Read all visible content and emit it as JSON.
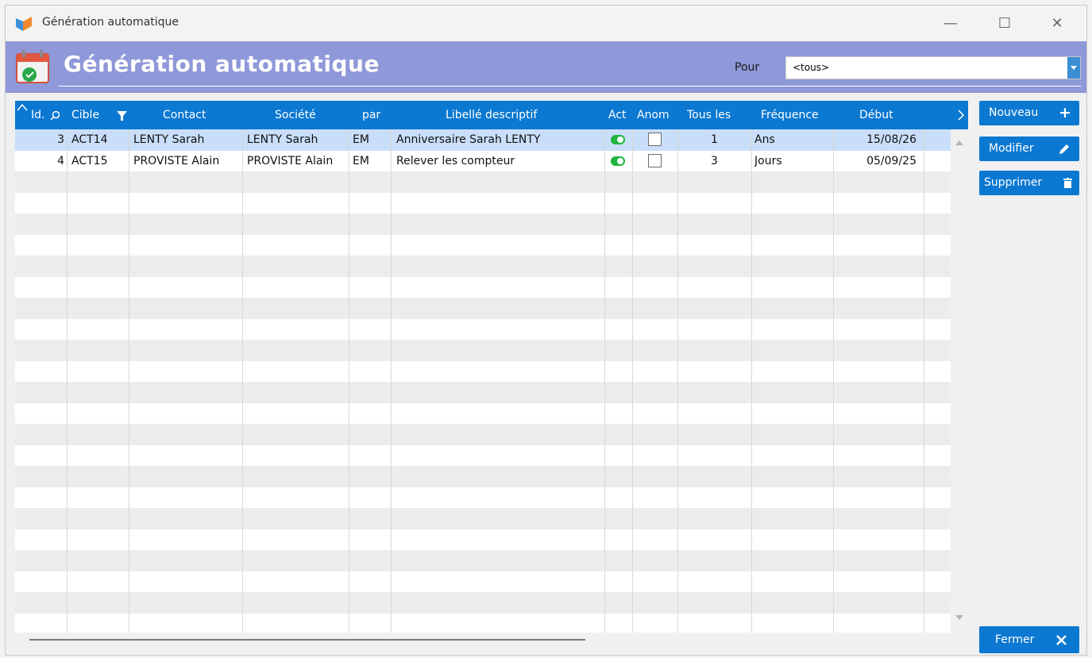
{
  "window": {
    "title": "Génération automatique",
    "controls": {
      "minimize": "—",
      "maximize": "☐",
      "close": "✕"
    }
  },
  "header": {
    "title": "Génération automatique",
    "pour_label": "Pour",
    "pour_value": "<tous>"
  },
  "table": {
    "columns": {
      "id": "Id.",
      "cible": "Cible",
      "contact": "Contact",
      "societe": "Société",
      "par": "par",
      "libelle": "Libellé descriptif",
      "act": "Act",
      "anom": "Anom",
      "tous_les": "Tous les",
      "frequence": "Fréquence",
      "debut": "Début"
    },
    "rows": [
      {
        "id": "3",
        "cible": "ACT14",
        "contact": "LENTY Sarah",
        "societe": "LENTY Sarah",
        "par": "EM",
        "libelle": "Anniversaire Sarah LENTY",
        "act": true,
        "anom": false,
        "tous_les": "1",
        "frequence": "Ans",
        "debut": "15/08/26"
      },
      {
        "id": "4",
        "cible": "ACT15",
        "contact": "PROVISTE Alain",
        "societe": "PROVISTE Alain",
        "par": "EM",
        "libelle": "Relever les compteur",
        "act": true,
        "anom": false,
        "tous_les": "3",
        "frequence": "Jours",
        "debut": "05/09/25"
      }
    ]
  },
  "buttons": {
    "nouveau": "Nouveau",
    "modifier": "Modifier",
    "supprimer": "Supprimer",
    "fermer": "Fermer"
  },
  "colors": {
    "header_bg": "#8f98d9",
    "accent": "#0b78d1",
    "selected_row": "#c9def8",
    "toggle_on": "#1eb43d"
  }
}
